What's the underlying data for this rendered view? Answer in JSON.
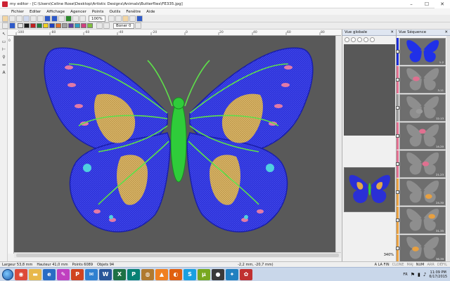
{
  "window": {
    "title": "my editor - [C:\\Users\\Celine Rose\\Desktop\\Artistic Designs\\Animals\\Butterflies\\FE335.jpg]",
    "buttons": [
      "–",
      "☐",
      "✕"
    ]
  },
  "menu": [
    "Fichier",
    "Editer",
    "Affichage",
    "Agencer",
    "Points",
    "Outils",
    "Fenêtre",
    "Aide"
  ],
  "toolbar": {
    "zoom": "100%",
    "object_select": "Boner 0"
  },
  "palette": [
    "#e3e3e3",
    "#1a1a1a",
    "#c02020",
    "#208040",
    "#f0d020",
    "#2040c0",
    "#e07030",
    "#a0a0a0",
    "#6040a0",
    "#30a0c0",
    "#d04080",
    "#80c040"
  ],
  "rulers": {
    "top_ticks": [
      "-100",
      "-80",
      "-60",
      "-40",
      "-20",
      "0",
      "20",
      "40",
      "60",
      "80"
    ],
    "left_label": "0"
  },
  "panels": {
    "overview_title": "Vue globale",
    "sequence_title": "Vue Séquence",
    "overview_zoom": "340%"
  },
  "sequence": [
    {
      "range": "1-2",
      "color": "#1a2bd8",
      "fill": "#2030e8"
    },
    {
      "range": "3-11",
      "color": "#e07090",
      "fill": "#e07090"
    },
    {
      "range": "12-13",
      "color": "#9a9a9a",
      "fill": "#9a9a9a"
    },
    {
      "range": "14-20",
      "color": "#e07090",
      "fill": "#e07090"
    },
    {
      "range": "21-23",
      "color": "#e07090",
      "fill": "#e07090"
    },
    {
      "range": "24-30",
      "color": "#e8a040",
      "fill": "#e8a040"
    },
    {
      "range": "31-35",
      "color": "#e8a040",
      "fill": "#e8a040"
    },
    {
      "range": "36-39",
      "color": "#e8a040",
      "fill": "#e8a040"
    }
  ],
  "status": {
    "width": "Largeur 53,8 mm",
    "height": "Hauteur 41,0 mm",
    "points": "Points 6089",
    "objects": "Objets 94",
    "coords": "-2,2 mm,  -20,7 mm)",
    "modes": [
      "A LA FIN",
      "CLONE",
      "MAJ",
      "NUM",
      "ARR",
      "DÉFIL"
    ]
  },
  "taskbar": {
    "apps": [
      {
        "name": "chrome-icon",
        "bg": "#dd4b39",
        "glyph": "◉"
      },
      {
        "name": "folder-icon",
        "bg": "#e8b84a",
        "glyph": "▬"
      },
      {
        "name": "explorer-icon",
        "bg": "#2a6cc4",
        "glyph": "e"
      },
      {
        "name": "embroidery-icon",
        "bg": "#c040c0",
        "glyph": "✎"
      },
      {
        "name": "powerpoint-icon",
        "bg": "#d04420",
        "glyph": "P"
      },
      {
        "name": "mail-icon",
        "bg": "#3080d0",
        "glyph": "✉"
      },
      {
        "name": "word-icon",
        "bg": "#2a5699",
        "glyph": "W"
      },
      {
        "name": "excel-icon",
        "bg": "#1e7145",
        "glyph": "X"
      },
      {
        "name": "publisher-icon",
        "bg": "#078174",
        "glyph": "P"
      },
      {
        "name": "thread-icon",
        "bg": "#b07a30",
        "glyph": "◍"
      },
      {
        "name": "vlc-icon",
        "bg": "#f08020",
        "glyph": "▲"
      },
      {
        "name": "firefox-icon",
        "bg": "#e06010",
        "glyph": "◐"
      },
      {
        "name": "skype-icon",
        "bg": "#1aa0e0",
        "glyph": "S"
      },
      {
        "name": "torrent-icon",
        "bg": "#78a820",
        "glyph": "μ"
      },
      {
        "name": "camera-icon",
        "bg": "#3a3a3a",
        "glyph": "●"
      },
      {
        "name": "game-icon",
        "bg": "#2080c0",
        "glyph": "✦"
      },
      {
        "name": "editor-icon",
        "bg": "#c03030",
        "glyph": "✿"
      }
    ],
    "lang": "FR",
    "time": "11:09 PM",
    "date": "6/17/2015"
  }
}
